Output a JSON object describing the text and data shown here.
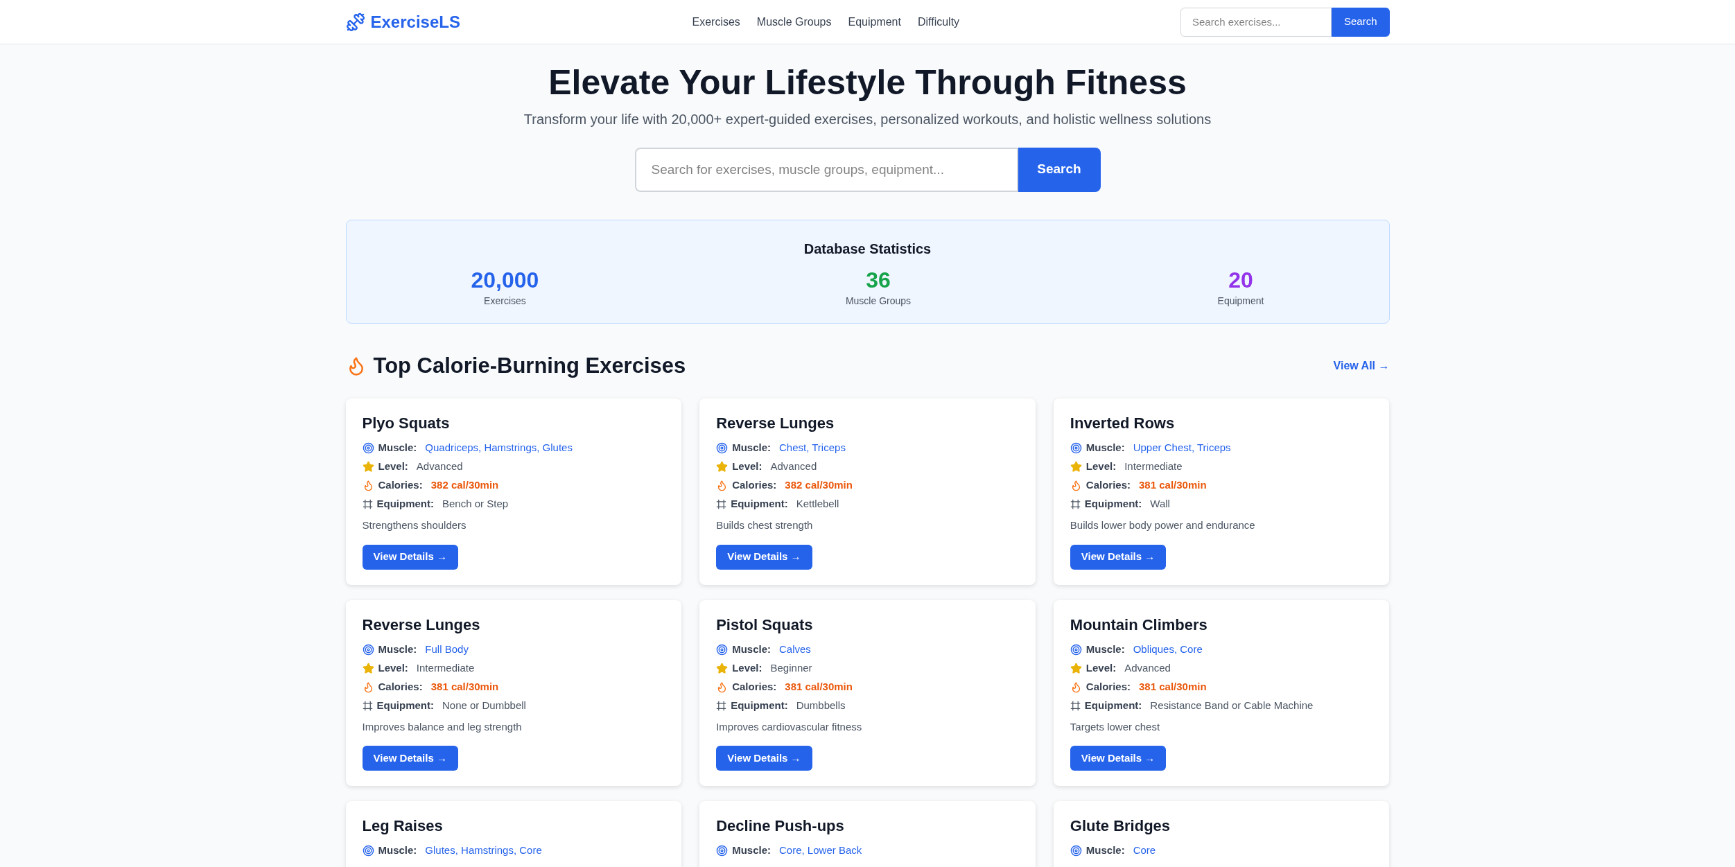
{
  "brand": "ExerciseLS",
  "nav": [
    "Exercises",
    "Muscle Groups",
    "Equipment",
    "Difficulty"
  ],
  "header_search": {
    "placeholder": "Search exercises...",
    "button": "Search"
  },
  "hero": {
    "title": "Elevate Your Lifestyle Through Fitness",
    "subtitle": "Transform your life with 20,000+ expert-guided exercises, personalized workouts, and holistic wellness solutions",
    "placeholder": "Search for exercises, muscle groups, equipment...",
    "button": "Search"
  },
  "stats": {
    "title": "Database Statistics",
    "items": [
      {
        "value": "20,000",
        "label": "Exercises",
        "color": "#2563eb"
      },
      {
        "value": "36",
        "label": "Muscle Groups",
        "color": "#16a34a"
      },
      {
        "value": "20",
        "label": "Equipment",
        "color": "#9333ea"
      }
    ]
  },
  "section": {
    "title": "Top Calorie-Burning Exercises",
    "link": "View All →"
  },
  "cards": [
    {
      "name": "Plyo Squats",
      "muscle_label": "Muscle:",
      "muscle": "Quadriceps, Hamstrings, Glutes",
      "level_label": "Level:",
      "level": "Advanced",
      "calories_label": "Calories:",
      "calories": "382 cal/30min",
      "equipment_label": "Equipment:",
      "equipment": "Bench or Step",
      "description": "Strengthens shoulders",
      "button": "View Details →"
    },
    {
      "name": "Reverse Lunges",
      "muscle_label": "Muscle:",
      "muscle": "Chest, Triceps",
      "level_label": "Level:",
      "level": "Advanced",
      "calories_label": "Calories:",
      "calories": "382 cal/30min",
      "equipment_label": "Equipment:",
      "equipment": "Kettlebell",
      "description": "Builds chest strength",
      "button": "View Details →"
    },
    {
      "name": "Inverted Rows",
      "muscle_label": "Muscle:",
      "muscle": "Upper Chest, Triceps",
      "level_label": "Level:",
      "level": "Intermediate",
      "calories_label": "Calories:",
      "calories": "381 cal/30min",
      "equipment_label": "Equipment:",
      "equipment": "Wall",
      "description": "Builds lower body power and endurance",
      "button": "View Details →"
    },
    {
      "name": "Reverse Lunges",
      "muscle_label": "Muscle:",
      "muscle": "Full Body",
      "level_label": "Level:",
      "level": "Intermediate",
      "calories_label": "Calories:",
      "calories": "381 cal/30min",
      "equipment_label": "Equipment:",
      "equipment": "None or Dumbbell",
      "description": "Improves balance and leg strength",
      "button": "View Details →"
    },
    {
      "name": "Pistol Squats",
      "muscle_label": "Muscle:",
      "muscle": "Calves",
      "level_label": "Level:",
      "level": "Beginner",
      "calories_label": "Calories:",
      "calories": "381 cal/30min",
      "equipment_label": "Equipment:",
      "equipment": "Dumbbells",
      "description": "Improves cardiovascular fitness",
      "button": "View Details →"
    },
    {
      "name": "Mountain Climbers",
      "muscle_label": "Muscle:",
      "muscle": "Obliques, Core",
      "level_label": "Level:",
      "level": "Advanced",
      "calories_label": "Calories:",
      "calories": "381 cal/30min",
      "equipment_label": "Equipment:",
      "equipment": "Resistance Band or Cable Machine",
      "description": "Targets lower chest",
      "button": "View Details →"
    },
    {
      "name": "Leg Raises",
      "muscle_label": "Muscle:",
      "muscle": "Glutes, Hamstrings, Core"
    },
    {
      "name": "Decline Push-ups",
      "muscle_label": "Muscle:",
      "muscle": "Core, Lower Back"
    },
    {
      "name": "Glute Bridges",
      "muscle_label": "Muscle:",
      "muscle": "Core"
    }
  ]
}
